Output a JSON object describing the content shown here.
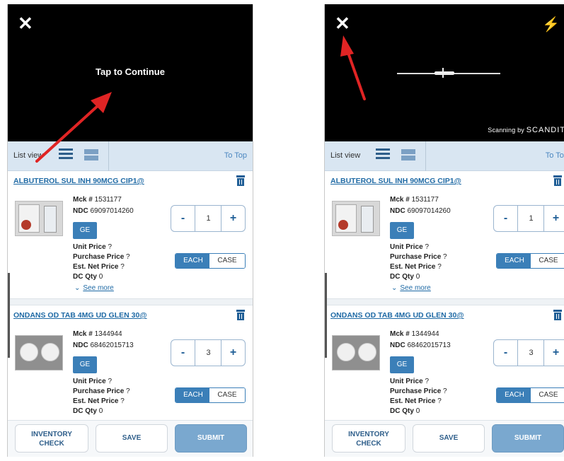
{
  "screens": [
    {
      "camera": {
        "tap_text": "Tap to Continue"
      },
      "toolbar": {
        "list_view": "List view",
        "to_top": "To Top"
      },
      "items": [
        {
          "title": "ALBUTEROL SUL INH 90MCG CIP1@",
          "mck_label": "Mck #",
          "mck": "1531177",
          "ndc_label": "NDC",
          "ndc": "69097014260",
          "ge": "GE",
          "qty": "1",
          "minus": "-",
          "plus": "+",
          "unit_price": "Unit Price",
          "unit_price_val": "?",
          "purchase_price": "Purchase Price",
          "purchase_price_val": "?",
          "net_price": "Est. Net Price",
          "net_price_val": "?",
          "dc_qty": "DC Qty",
          "dc_qty_val": "0",
          "each": "EACH",
          "case": "CASE",
          "see_more": "See more"
        },
        {
          "title": "ONDANS OD TAB 4MG UD GLEN 30@",
          "mck_label": "Mck #",
          "mck": "1344944",
          "ndc_label": "NDC",
          "ndc": "68462015713",
          "ge": "GE",
          "qty": "3",
          "minus": "-",
          "plus": "+",
          "unit_price": "Unit Price",
          "unit_price_val": "?",
          "purchase_price": "Purchase Price",
          "purchase_price_val": "?",
          "net_price": "Est. Net Price",
          "net_price_val": "?",
          "dc_qty": "DC Qty",
          "dc_qty_val": "0",
          "each": "EACH",
          "case": "CASE"
        }
      ],
      "buttons": {
        "inventory_1": "INVENTORY",
        "inventory_2": "CHECK",
        "save": "SAVE",
        "submit": "SUBMIT"
      }
    },
    {
      "camera": {
        "powered_prefix": "Scanning by",
        "powered_brand": "SCANDIT"
      },
      "toolbar": {
        "list_view": "List view",
        "to_top": "To Top"
      },
      "items": [
        {
          "title": "ALBUTEROL SUL INH 90MCG CIP1@",
          "mck_label": "Mck #",
          "mck": "1531177",
          "ndc_label": "NDC",
          "ndc": "69097014260",
          "ge": "GE",
          "qty": "1",
          "minus": "-",
          "plus": "+",
          "unit_price": "Unit Price",
          "unit_price_val": "?",
          "purchase_price": "Purchase Price",
          "purchase_price_val": "?",
          "net_price": "Est. Net Price",
          "net_price_val": "?",
          "dc_qty": "DC Qty",
          "dc_qty_val": "0",
          "each": "EACH",
          "case": "CASE",
          "see_more": "See more"
        },
        {
          "title": "ONDANS OD TAB 4MG UD GLEN 30@",
          "mck_label": "Mck #",
          "mck": "1344944",
          "ndc_label": "NDC",
          "ndc": "68462015713",
          "ge": "GE",
          "qty": "3",
          "minus": "-",
          "plus": "+",
          "unit_price": "Unit Price",
          "unit_price_val": "?",
          "purchase_price": "Purchase Price",
          "purchase_price_val": "?",
          "net_price": "Est. Net Price",
          "net_price_val": "?",
          "dc_qty": "DC Qty",
          "dc_qty_val": "0",
          "each": "EACH",
          "case": "CASE"
        }
      ],
      "buttons": {
        "inventory_1": "INVENTORY",
        "inventory_2": "CHECK",
        "save": "SAVE",
        "submit": "SUBMIT"
      }
    }
  ],
  "colors": {
    "camera_bg": "#000000",
    "toolbar_bg": "#d9e6f2",
    "link": "#1f6aa5",
    "accent": "#3b7fb8",
    "submit": "#7aa8cf",
    "annotation_arrow": "#e02424"
  },
  "icons": [
    "close-icon",
    "flash-icon",
    "list-view-icon",
    "card-view-icon",
    "trash-icon",
    "chevron-down-icon",
    "annotation-arrow"
  ]
}
